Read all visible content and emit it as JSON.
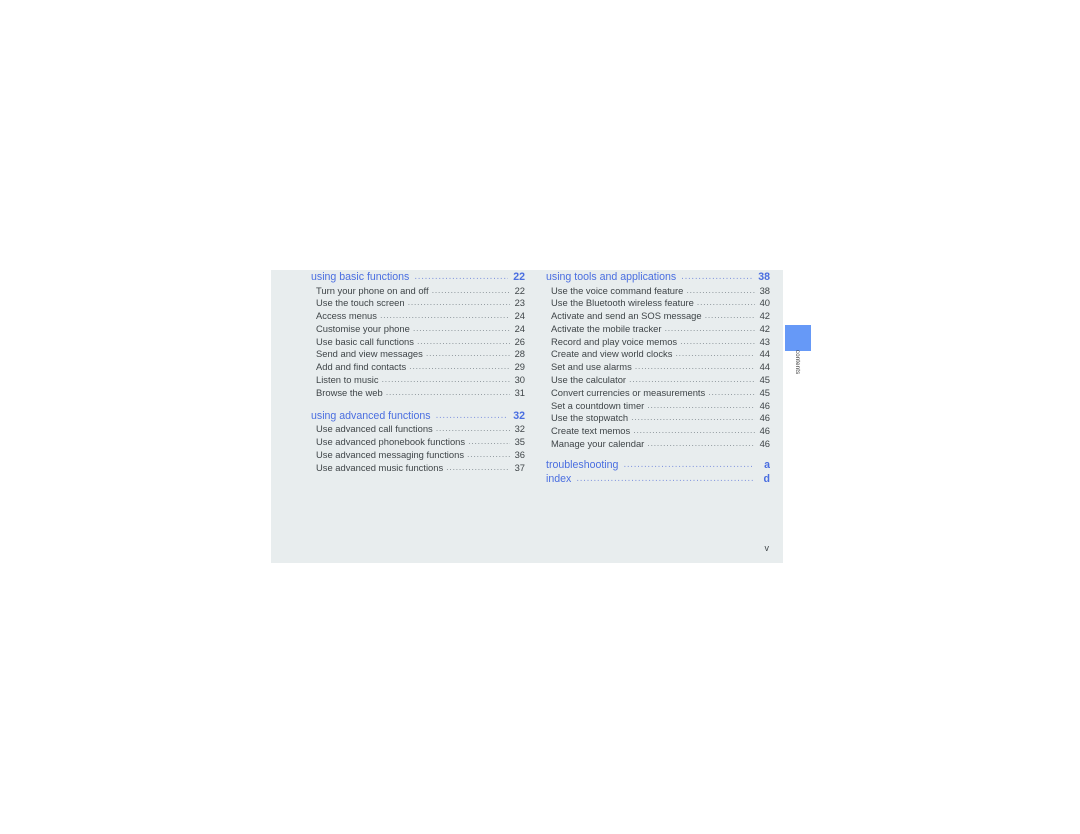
{
  "document": {
    "page_folio": "v",
    "side_tab_label": "contents",
    "accent_color": "#4a6ee0",
    "tab_color": "#6699f7",
    "page_background": "#e8edee"
  },
  "columns": {
    "left": [
      {
        "type": "heading",
        "label": "using basic functions",
        "page": "22"
      },
      {
        "type": "entry",
        "label": "Turn your phone on and off",
        "page": "22"
      },
      {
        "type": "entry",
        "label": "Use the touch screen",
        "page": "23"
      },
      {
        "type": "entry",
        "label": "Access menus",
        "page": "24"
      },
      {
        "type": "entry",
        "label": "Customise your phone",
        "page": "24"
      },
      {
        "type": "entry",
        "label": "Use basic call functions",
        "page": "26"
      },
      {
        "type": "entry",
        "label": "Send and view messages",
        "page": "28"
      },
      {
        "type": "entry",
        "label": "Add and find contacts",
        "page": "29"
      },
      {
        "type": "entry",
        "label": "Listen to music",
        "page": "30"
      },
      {
        "type": "entry",
        "label": "Browse the web",
        "page": "31"
      },
      {
        "type": "spacer"
      },
      {
        "type": "heading",
        "label": "using advanced functions",
        "page": "32"
      },
      {
        "type": "entry",
        "label": "Use advanced call functions",
        "page": "32"
      },
      {
        "type": "entry",
        "label": "Use advanced phonebook functions",
        "page": "35"
      },
      {
        "type": "entry",
        "label": "Use advanced messaging functions",
        "page": "36"
      },
      {
        "type": "entry",
        "label": "Use advanced music functions",
        "page": "37"
      }
    ],
    "right": [
      {
        "type": "heading",
        "label": "using tools and applications",
        "page": "38"
      },
      {
        "type": "entry",
        "label": "Use the voice command feature",
        "page": "38"
      },
      {
        "type": "entry",
        "label": "Use the Bluetooth wireless feature",
        "page": "40"
      },
      {
        "type": "entry",
        "label": "Activate and send an SOS message",
        "page": "42"
      },
      {
        "type": "entry",
        "label": "Activate the mobile tracker",
        "page": "42"
      },
      {
        "type": "entry",
        "label": "Record and play voice memos",
        "page": "43"
      },
      {
        "type": "entry",
        "label": "Create and view world clocks",
        "page": "44"
      },
      {
        "type": "entry",
        "label": "Set and use alarms",
        "page": "44"
      },
      {
        "type": "entry",
        "label": "Use the calculator",
        "page": "45"
      },
      {
        "type": "entry",
        "label": "Convert currencies or measurements",
        "page": "45"
      },
      {
        "type": "entry",
        "label": "Set a countdown timer",
        "page": "46"
      },
      {
        "type": "entry",
        "label": "Use the stopwatch",
        "page": "46"
      },
      {
        "type": "entry",
        "label": "Create text memos",
        "page": "46"
      },
      {
        "type": "entry",
        "label": "Manage your calendar",
        "page": "46"
      },
      {
        "type": "spacer-sm"
      },
      {
        "type": "heading",
        "label": "troubleshooting",
        "page": "a"
      },
      {
        "type": "heading",
        "label": "index",
        "page": "d"
      }
    ]
  }
}
